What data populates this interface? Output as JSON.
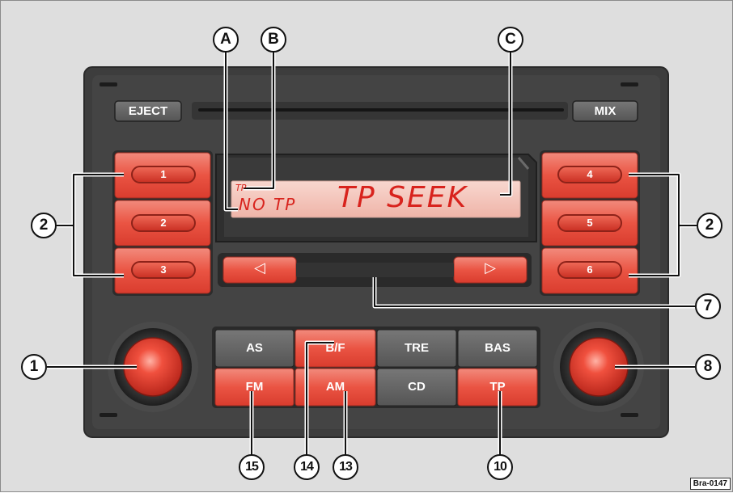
{
  "buttons": {
    "eject": "EJECT",
    "mix": "MIX",
    "preset_1": "1",
    "preset_2": "2",
    "preset_3": "3",
    "preset_4": "4",
    "preset_5": "5",
    "preset_6": "6",
    "seek_left": "◁",
    "seek_right": "▷",
    "as": "AS",
    "bf": "B/F",
    "tre": "TRE",
    "bas": "BAS",
    "fm": "FM",
    "am": "AM",
    "cd": "CD",
    "tp": "TP"
  },
  "display": {
    "tp_small": "TP",
    "no_tp": "NO TP",
    "main": "TP SEEK"
  },
  "callouts": {
    "A": "A",
    "B": "B",
    "C": "C",
    "n1": "1",
    "n2_left": "2",
    "n2_right": "2",
    "n7": "7",
    "n8": "8",
    "n10": "10",
    "n13": "13",
    "n14": "14",
    "n15": "15"
  },
  "reference": "Bra-0147",
  "colors": {
    "button_red": "#e8463a",
    "panel_dark": "#3f3f3f",
    "lcd_bg": "#f5c9c0",
    "lcd_text": "#d8231d"
  }
}
